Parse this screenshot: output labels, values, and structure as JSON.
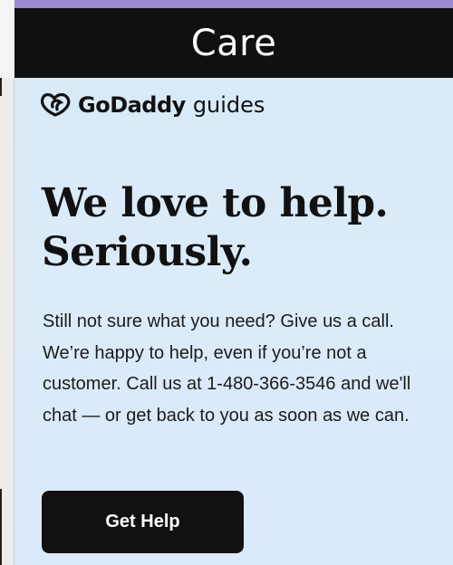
{
  "header": {
    "title": "Care"
  },
  "brand": {
    "name": "GoDaddy",
    "suffix": "guides",
    "icon": "godaddy-logo-icon"
  },
  "main": {
    "headline_line_1": "We love to help.",
    "headline_line_2": "Seriously.",
    "body": "Still not sure what you need? Give us a call. We’re happy to help, even if you’re not a customer. Call us at 1-480-366-3546 and we'll chat — or get back to you as soon as we can.",
    "button_label": "Get Help"
  },
  "colors": {
    "header_background": "#101010",
    "accent_strip": "#9a8ad3",
    "content_background": "#d8e9f8",
    "button_background": "#111111",
    "text": "#111111"
  }
}
